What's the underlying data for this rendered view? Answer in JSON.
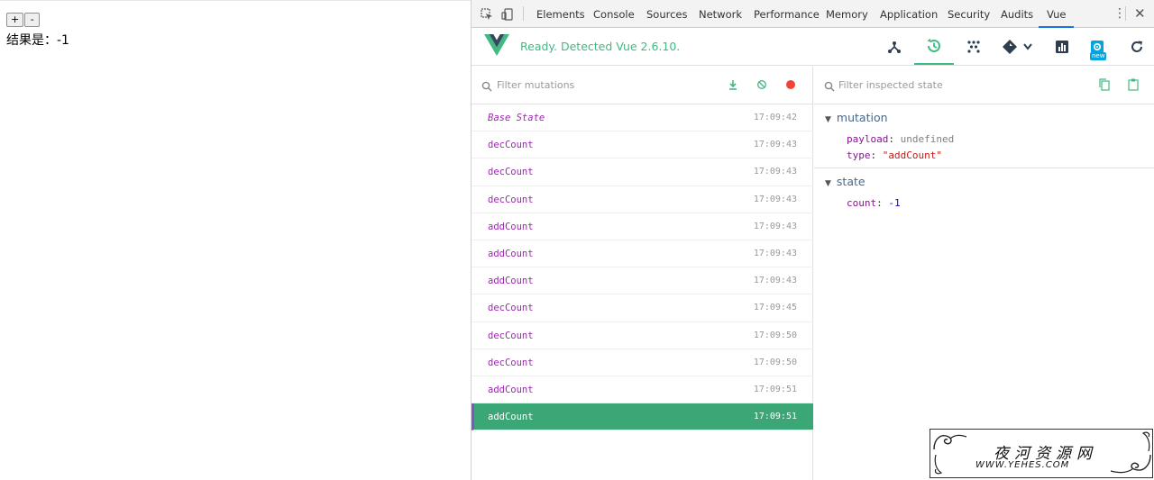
{
  "page": {
    "plus_label": "+",
    "minus_label": "-",
    "result_text": "结果是：-1"
  },
  "devtools": {
    "tabs": [
      {
        "label": "Elements"
      },
      {
        "label": "Console"
      },
      {
        "label": "Sources"
      },
      {
        "label": "Network"
      },
      {
        "label": "Performance"
      },
      {
        "label": "Memory"
      },
      {
        "label": "Application"
      },
      {
        "label": "Security"
      },
      {
        "label": "Audits"
      },
      {
        "label": "Vue"
      }
    ],
    "active_tab": "Vue",
    "close_glyph": "✕",
    "menu_glyph": "⋮"
  },
  "vue": {
    "status": "Ready. Detected Vue 2.6.10.",
    "new_badge": "new",
    "colors": {
      "brand": "#42b983",
      "active_row": "#3ba776",
      "active_border": "#7e57c2"
    },
    "icons": [
      "components-icon",
      "vuex-history-icon",
      "events-icon",
      "routing-icon",
      "performance-icon",
      "settings-icon",
      "refresh-icon"
    ]
  },
  "mutations": {
    "filter_placeholder": "Filter mutations",
    "items": [
      {
        "name": "Base State",
        "time": "17:09:42"
      },
      {
        "name": "decCount",
        "time": "17:09:43"
      },
      {
        "name": "decCount",
        "time": "17:09:43"
      },
      {
        "name": "decCount",
        "time": "17:09:43"
      },
      {
        "name": "addCount",
        "time": "17:09:43"
      },
      {
        "name": "addCount",
        "time": "17:09:43"
      },
      {
        "name": "addCount",
        "time": "17:09:43"
      },
      {
        "name": "decCount",
        "time": "17:09:45"
      },
      {
        "name": "decCount",
        "time": "17:09:50"
      },
      {
        "name": "decCount",
        "time": "17:09:50"
      },
      {
        "name": "addCount",
        "time": "17:09:51"
      },
      {
        "name": "addCount",
        "time": "17:09:51"
      }
    ]
  },
  "state": {
    "filter_placeholder": "Filter inspected state",
    "mutation_label": "mutation",
    "payload_key": "payload",
    "payload_value": "undefined",
    "type_key": "type",
    "type_value": "\"addCount\"",
    "state_label": "state",
    "count_key": "count",
    "count_value": "-1",
    "colon": ":"
  },
  "watermark": {
    "title": "夜河资源网",
    "url": "WWW.YEHES.COM"
  }
}
